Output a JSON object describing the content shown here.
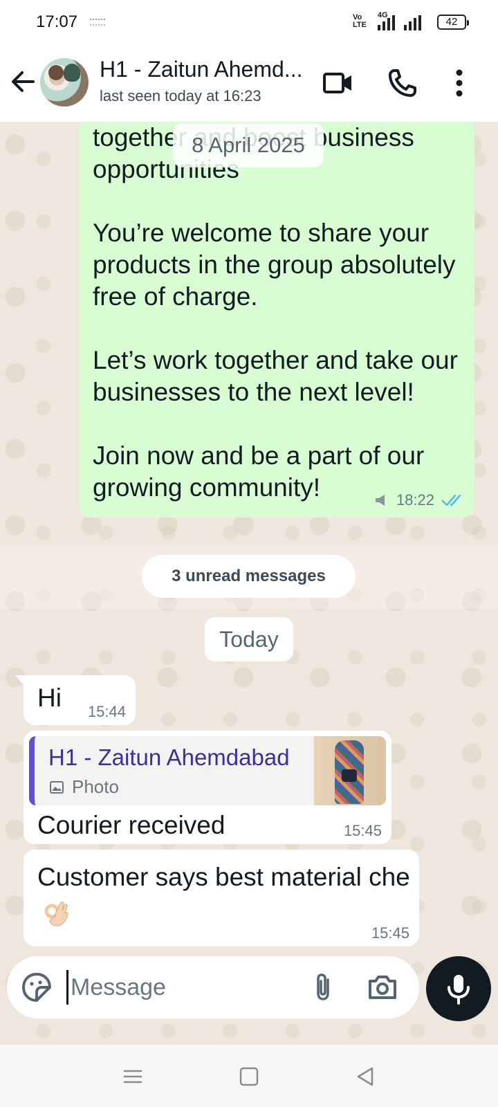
{
  "status_bar": {
    "time": "17:07",
    "volte_label": "VoLTE",
    "network_label": "4G",
    "battery": "42"
  },
  "header": {
    "contact_name": "H1 - Zaitun Ahemd...",
    "last_seen": "last seen today at 16:23",
    "icons": [
      "back-arrow-icon",
      "video-call-icon",
      "voice-call-icon",
      "more-options-icon"
    ]
  },
  "chat": {
    "date_chip": "8 April 2025",
    "outgoing_message": {
      "cut_line_1": "together and boost business",
      "cut_line_2": "opportunities",
      "paragraph_1": "You’re welcome to share your products in the group absolutely free of charge.",
      "paragraph_2": "Let’s work together and take our businesses to the next level!",
      "paragraph_3": "Join now and be a part of our growing community!",
      "time": "18:22",
      "status": "read"
    },
    "unread_banner": "3 unread messages",
    "today_chip": "Today",
    "incoming_messages": [
      {
        "text": "Hi",
        "time": "15:44"
      },
      {
        "quoted_name": "H1 - Zaitun Ahemdabad",
        "quoted_type": "Photo",
        "text": "Courier received",
        "time": "15:45"
      },
      {
        "text": "Customer says best material che",
        "emoji": "ok-hand",
        "time": "15:45"
      }
    ]
  },
  "composer": {
    "placeholder": "Message",
    "value": ""
  },
  "colors": {
    "outgoing_bubble": "#d9fdd3",
    "incoming_bubble": "#ffffff",
    "chat_background": "#efe7dd",
    "read_ticks": "#53bdeb",
    "quote_bar": "#5b4fd6"
  }
}
